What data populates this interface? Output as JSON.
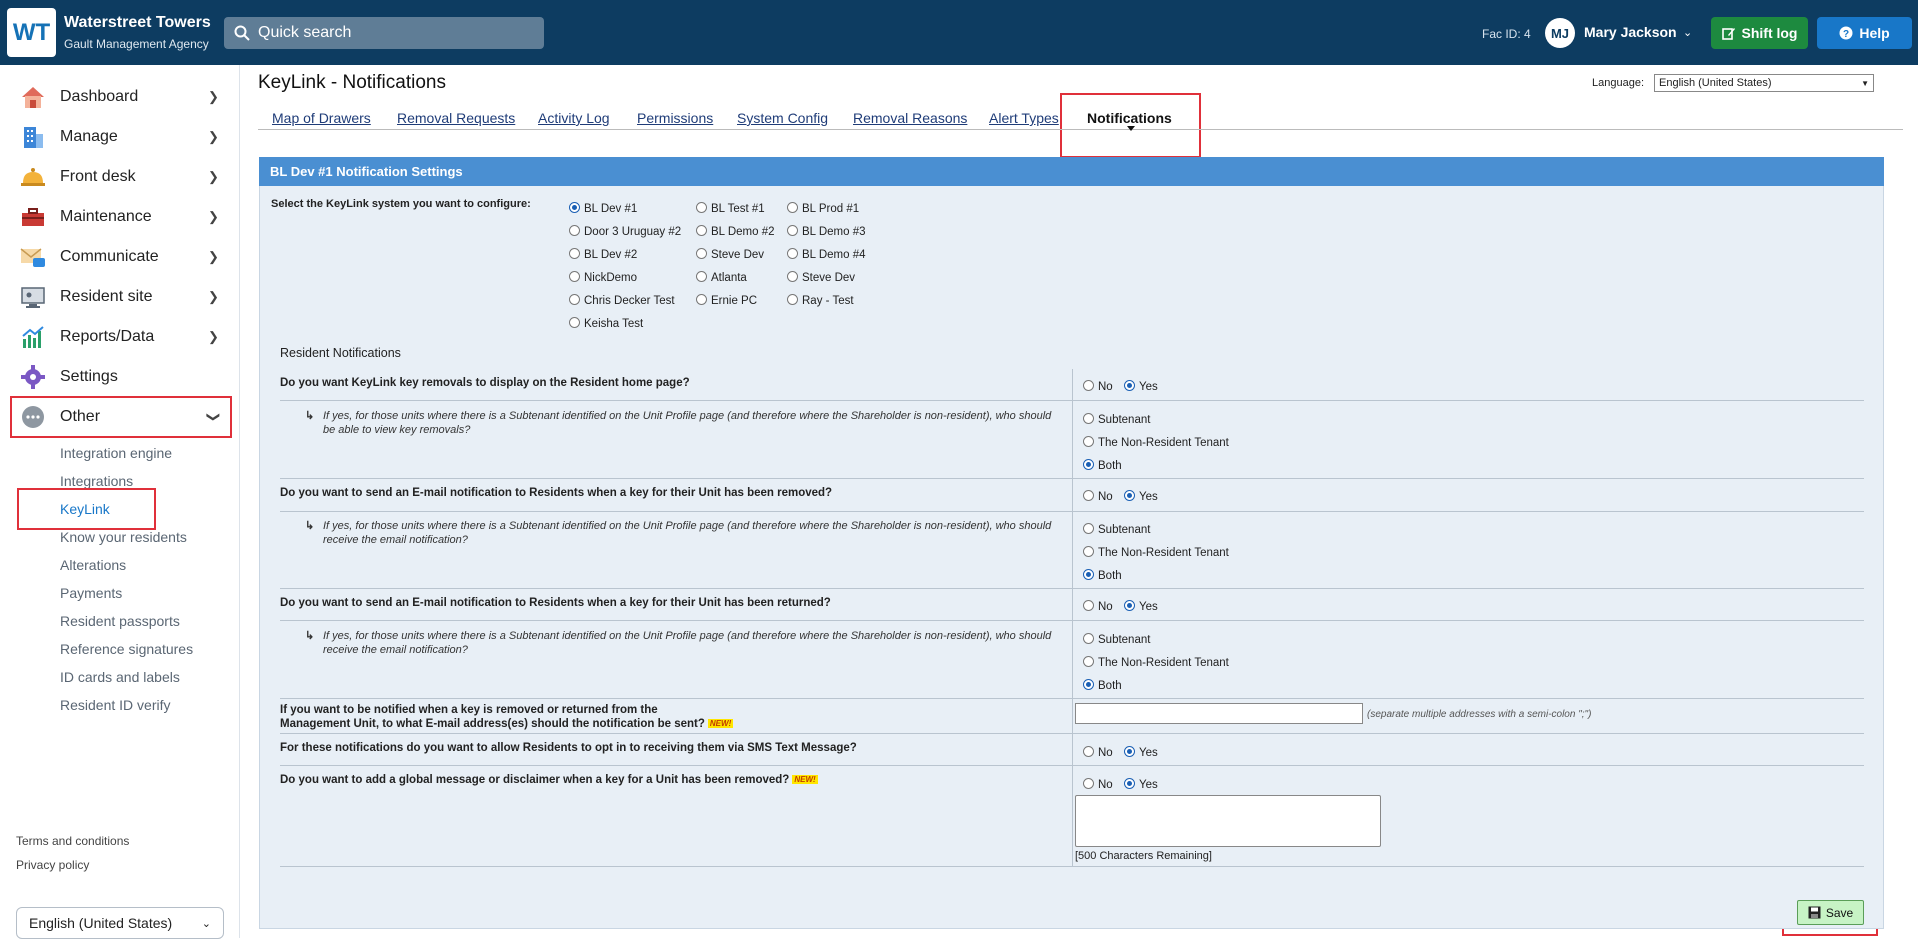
{
  "header": {
    "logo": "WT",
    "org_name": "Waterstreet Towers",
    "org_sub": "Gault Management Agency",
    "search_label": "Quick search",
    "fac_id": "Fac ID: 4",
    "avatar": "MJ",
    "user_name": "Mary Jackson",
    "shift_log": "Shift log",
    "help": "Help"
  },
  "sidebar": {
    "items": [
      {
        "label": "Dashboard",
        "icon": "house-icon"
      },
      {
        "label": "Manage",
        "icon": "building-icon"
      },
      {
        "label": "Front desk",
        "icon": "bell-icon"
      },
      {
        "label": "Maintenance",
        "icon": "toolbox-icon"
      },
      {
        "label": "Communicate",
        "icon": "envelope-icon"
      },
      {
        "label": "Resident site",
        "icon": "monitor-icon"
      },
      {
        "label": "Reports/Data",
        "icon": "bar-chart-icon"
      },
      {
        "label": "Settings",
        "icon": "gear-icon"
      },
      {
        "label": "Other",
        "icon": "more-icon"
      }
    ],
    "sub_items": [
      "Integration engine",
      "Integrations",
      "KeyLink",
      "Know your residents",
      "Alterations",
      "Payments",
      "Resident passports",
      "Reference signatures",
      "ID cards and labels",
      "Resident ID verify"
    ],
    "terms": "Terms and conditions",
    "privacy": "Privacy policy",
    "language": "English (United States)"
  },
  "page": {
    "title": "KeyLink - Notifications",
    "language_label": "Language:",
    "language_value": "English (United States)",
    "tabs": [
      "Map of Drawers",
      "Removal Requests",
      "Activity Log",
      "Permissions",
      "System Config",
      "Removal Reasons",
      "Alert Types",
      "Notifications"
    ]
  },
  "panel": {
    "header": "BL Dev #1  Notification Settings",
    "select_label": "Select the KeyLink system you want to configure:",
    "systems": [
      {
        "label": "BL Dev #1",
        "selected": true
      },
      {
        "label": "BL Test #1",
        "selected": false
      },
      {
        "label": "BL Prod #1",
        "selected": false
      },
      {
        "label": "Door 3 Uruguay #2",
        "selected": false
      },
      {
        "label": "BL Demo #2",
        "selected": false
      },
      {
        "label": "BL Demo #3",
        "selected": false
      },
      {
        "label": "BL Dev #2",
        "selected": false
      },
      {
        "label": "Steve Dev",
        "selected": false
      },
      {
        "label": "BL Demo #4",
        "selected": false
      },
      {
        "label": "NickDemo",
        "selected": false
      },
      {
        "label": "Atlanta",
        "selected": false
      },
      {
        "label": "Steve Dev",
        "selected": false
      },
      {
        "label": "Chris Decker Test",
        "selected": false
      },
      {
        "label": "Ernie PC",
        "selected": false
      },
      {
        "label": "Ray - Test",
        "selected": false
      },
      {
        "label": "Keisha Test",
        "selected": false
      }
    ],
    "section_title": "Resident Notifications",
    "q1": "Do you want KeyLink key removals to display on the Resident home page?",
    "q1_sub": "If yes, for those units where there is a Subtenant identified on the Unit Profile page (and therefore where the Shareholder is non-resident), who should be able to view key removals?",
    "q2": "Do you want to send an E-mail notification to Residents when a key for their Unit has been removed?",
    "q2_sub": "If yes, for those units where there is a Subtenant identified on the Unit Profile page (and therefore where the Shareholder is non-resident), who should receive the email notification?",
    "q3": "Do you want to send an E-mail notification to Residents when a key for their Unit has been returned?",
    "q3_sub": "If yes, for those units where there is a Subtenant identified on the Unit Profile page (and therefore where the Shareholder is non-resident), who should receive the email notification?",
    "q4_line1": "If you want to be notified when a key is removed or returned from the",
    "q4_line2": "Management Unit, to what E-mail address(es) should the notification be sent?",
    "q4_hint": "(separate multiple addresses with a semi-colon \";\")",
    "q5": "For these notifications do you want to allow Residents to opt in to receiving them via SMS Text Message?",
    "q6": "Do you want to add a global message or disclaimer when a key for a Unit has been removed?",
    "new_badge": "NEW!",
    "no": "No",
    "yes": "Yes",
    "subtenant": "Subtenant",
    "non_resident": "The Non-Resident Tenant",
    "both": "Both",
    "chars_remaining": "[500 Characters Remaining]",
    "save": "Save"
  }
}
